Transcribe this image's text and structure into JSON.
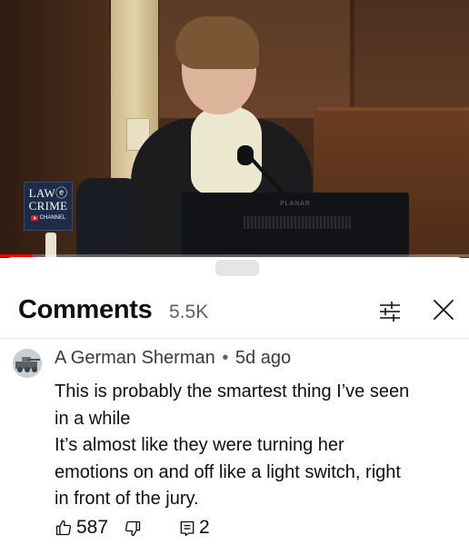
{
  "video": {
    "logo": {
      "line1": "LAWⓔ",
      "line2": "CRIME",
      "channel": "CHANNEL"
    },
    "monitor_brand": "PLANAR",
    "progress_fraction": 0.07,
    "progress_color": "#ff0000"
  },
  "comments_panel": {
    "title": "Comments",
    "count": "5.5K",
    "icons": {
      "filter": "sliders-icon",
      "close": "close-icon"
    }
  },
  "comment": {
    "author": "A German Sherman",
    "separator": "•",
    "age": "5d ago",
    "lines": [
      "This is probably the smartest thing I’ve seen",
      "in a while",
      "It’s almost like they were turning her",
      "emotions on and off like a light switch, right",
      "in front of the jury."
    ],
    "likes": "587",
    "replies": "2",
    "icons": {
      "like": "thumbs-up-icon",
      "dislike": "thumbs-down-icon",
      "reply": "reply-icon"
    }
  },
  "colors": {
    "text_primary": "#0f0f0f",
    "text_secondary": "#606060",
    "divider": "#e5e5e5",
    "accent_red": "#ff0000"
  }
}
